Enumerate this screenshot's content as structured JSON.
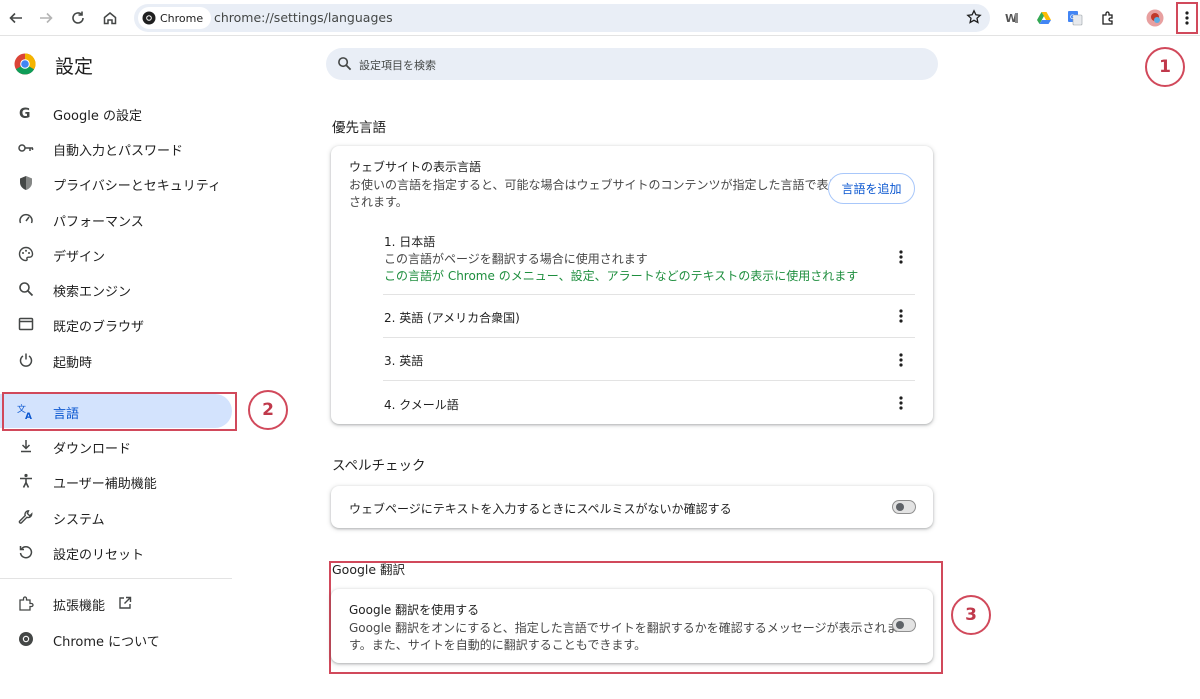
{
  "browser": {
    "chip_label": "Chrome",
    "url": "chrome://settings/languages"
  },
  "annotations": [
    "1",
    "2",
    "3"
  ],
  "sidebar": {
    "title": "設定",
    "items": [
      {
        "label": "Google の設定",
        "icon": "google-g-icon"
      },
      {
        "label": "自動入力とパスワード",
        "icon": "key-icon"
      },
      {
        "label": "プライバシーとセキュリティ",
        "icon": "shield-icon"
      },
      {
        "label": "パフォーマンス",
        "icon": "speedometer-icon"
      },
      {
        "label": "デザイン",
        "icon": "palette-icon"
      },
      {
        "label": "検索エンジン",
        "icon": "search-icon"
      },
      {
        "label": "既定のブラウザ",
        "icon": "browser-window-icon"
      },
      {
        "label": "起動時",
        "icon": "power-icon"
      },
      {
        "label": "言語",
        "icon": "translate-icon",
        "active": true
      },
      {
        "label": "ダウンロード",
        "icon": "download-icon"
      },
      {
        "label": "ユーザー補助機能",
        "icon": "accessibility-icon"
      },
      {
        "label": "システム",
        "icon": "wrench-icon"
      },
      {
        "label": "設定のリセット",
        "icon": "reset-icon"
      }
    ],
    "extensions_label": "拡張機能",
    "about_label": "Chrome について"
  },
  "search": {
    "placeholder": "設定項目を検索"
  },
  "preferred_languages": {
    "section_title": "優先言語",
    "card_title": "ウェブサイトの表示言語",
    "description_line1": "お使いの言語を指定すると、可能な場合はウェブサイトのコンテンツが指定した言語で表示",
    "description_line2": "されます。",
    "add_button": "言語を追加",
    "languages": [
      {
        "label": "1. 日本語",
        "note": "この言語がページを翻訳する場合に使用されます",
        "ui_note": "この言語が Chrome のメニュー、設定、アラートなどのテキストの表示に使用されます"
      },
      {
        "label": "2. 英語 (アメリカ合衆国)"
      },
      {
        "label": "3. 英語"
      },
      {
        "label": "4. クメール語"
      }
    ]
  },
  "spellcheck": {
    "section_title": "スペルチェック",
    "label": "ウェブページにテキストを入力するときにスペルミスがないか確認する",
    "enabled": false
  },
  "google_translate": {
    "section_title": "Google 翻訳",
    "title": "Google 翻訳を使用する",
    "description_line1": "Google 翻訳をオンにすると、指定した言語でサイトを翻訳するかを確認するメッセージが表示されま",
    "description_line2": "す。また、サイトを自動的に翻訳することもできます。",
    "enabled": false
  },
  "colors": {
    "accent": "#0b57d0",
    "active_nav_bg": "#d3e3fd",
    "annotation_red": "#d1495b",
    "green_note": "#1e8e3e"
  }
}
